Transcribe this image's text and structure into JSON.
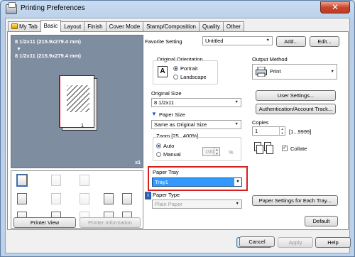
{
  "window": {
    "title": "Printing Preferences",
    "close_glyph": "✕"
  },
  "tabs": [
    {
      "label": "My Tab",
      "active": false,
      "has_icon": true
    },
    {
      "label": "Basic",
      "active": true
    },
    {
      "label": "Layout",
      "active": false
    },
    {
      "label": "Finish",
      "active": false
    },
    {
      "label": "Cover Mode",
      "active": false
    },
    {
      "label": "Stamp/Composition",
      "active": false
    },
    {
      "label": "Quality",
      "active": false
    },
    {
      "label": "Other",
      "active": false
    }
  ],
  "preview": {
    "line1": "8 1/2x11 (215.9x279.4 mm)",
    "arrow": "▼",
    "line2": "8 1/2x11 (215.9x279.4 mm)",
    "page_number": "1",
    "copies_badge": "x1"
  },
  "left_buttons": {
    "printer_view": "Printer View",
    "printer_information": "Printer Information"
  },
  "favorite": {
    "label": "Favorite Setting",
    "value": "Untitled",
    "add": "Add...",
    "edit": "Edit..."
  },
  "orientation": {
    "label": "Original Orientation",
    "portrait": "Portrait",
    "landscape": "Landscape",
    "selected": "Portrait",
    "icon_letter": "A"
  },
  "original_size": {
    "label": "Original Size",
    "value": "8 1/2x11"
  },
  "paper_size": {
    "label": "Paper Size",
    "value": "Same as Original Size"
  },
  "zoom": {
    "label": "Zoom [25...400%]",
    "auto": "Auto",
    "manual": "Manual",
    "selected": "Auto",
    "value": "100",
    "unit": "%"
  },
  "paper_tray": {
    "label": "Paper Tray",
    "value": "Tray1"
  },
  "paper_type": {
    "label": "Paper Type",
    "value": "Plain Paper"
  },
  "output": {
    "label": "Output Method",
    "value": "Print"
  },
  "right_buttons": {
    "user_settings": "User Settings...",
    "auth_tracking": "Authentication/Account Track...",
    "paper_settings": "Paper Settings for Each Tray...",
    "default": "Default"
  },
  "copies": {
    "label": "Copies",
    "value": "1",
    "range": "[1...9999]",
    "collate": "Collate",
    "collate_checked": true
  },
  "dialog": {
    "ok": "OK",
    "cancel": "Cancel",
    "apply": "Apply",
    "help": "Help"
  },
  "colors": {
    "highlight": "#3399ff",
    "callout": "#d81f1f",
    "preview_bg": "#7e8da0"
  },
  "icons": {
    "app": "printer-icon",
    "tray_bullet": "blue-down-arrow-icon",
    "info": "info-icon"
  }
}
